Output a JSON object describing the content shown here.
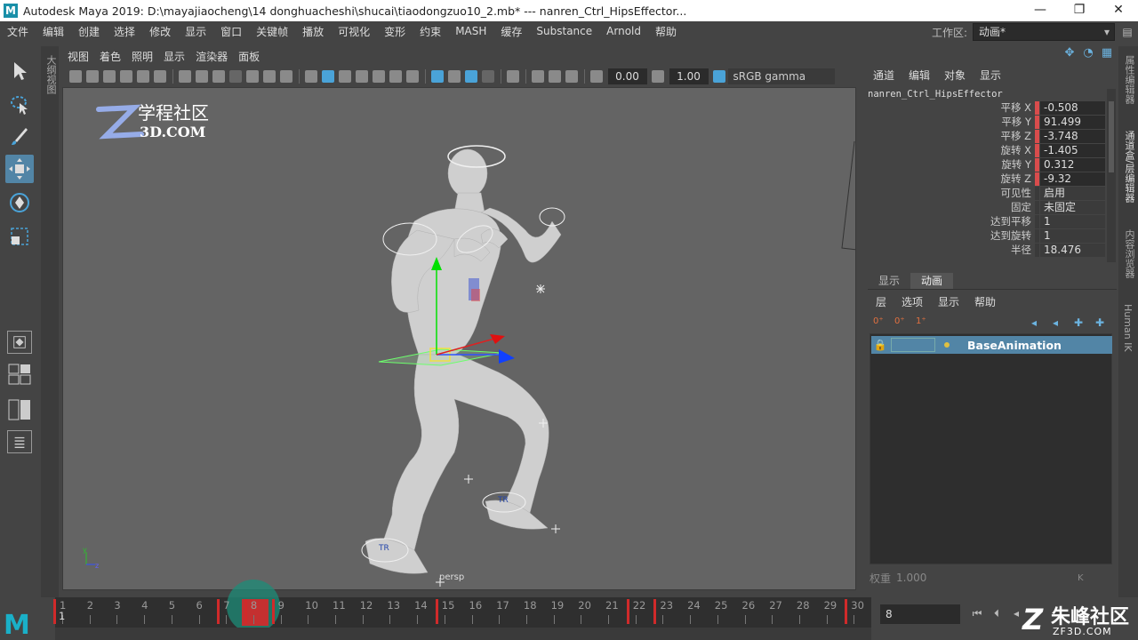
{
  "titlebar": {
    "title": "Autodesk Maya 2019: D:\\mayajiaocheng\\14 donghuacheshi\\shucai\\tiaodongzuo10_2.mb*   ---   nanren_Ctrl_HipsEffector...",
    "logo": "M",
    "buttons": [
      "—",
      "❐",
      "✕"
    ]
  },
  "menubar": {
    "items": [
      "文件",
      "编辑",
      "创建",
      "选择",
      "修改",
      "显示",
      "窗口",
      "关键帧",
      "播放",
      "可视化",
      "变形",
      "约束",
      "MASH",
      "缓存",
      "Substance",
      "Arnold",
      "帮助"
    ],
    "workspace_label": "工作区:",
    "workspace_value": "动画*"
  },
  "viewport": {
    "menus": [
      "视图",
      "着色",
      "照明",
      "显示",
      "渲染器",
      "面板"
    ],
    "near_value": "0.00",
    "far_value": "1.00",
    "color_space": "sRGB gamma",
    "camera": "persp",
    "outliner_tab": "大纲视图"
  },
  "watermark": {
    "cn": "学程社区",
    "en": "3D.COM"
  },
  "channel_box": {
    "menus": [
      "通道",
      "编辑",
      "对象",
      "显示"
    ],
    "node": "nanren_Ctrl_HipsEffector",
    "channels": [
      {
        "name": "平移 X",
        "value": "-0.508",
        "keyed": true
      },
      {
        "name": "平移 Y",
        "value": "91.499",
        "keyed": true
      },
      {
        "name": "平移 Z",
        "value": "-3.748",
        "keyed": true
      },
      {
        "name": "旋转 X",
        "value": "-1.405",
        "keyed": true
      },
      {
        "name": "旋转 Y",
        "value": "0.312",
        "keyed": true
      },
      {
        "name": "旋转 Z",
        "value": "-9.32",
        "keyed": true
      },
      {
        "name": "可见性",
        "value": "启用",
        "keyed": false
      },
      {
        "name": "固定",
        "value": "未固定",
        "keyed": false
      },
      {
        "name": "达到平移",
        "value": "1",
        "keyed": false
      },
      {
        "name": "达到旋转",
        "value": "1",
        "keyed": false
      },
      {
        "name": "半径",
        "value": "18.476",
        "keyed": false
      }
    ]
  },
  "layer_editor": {
    "tabs": [
      "显示",
      "动画"
    ],
    "menus": [
      "层",
      "选项",
      "显示",
      "帮助"
    ],
    "layer_name": "BaseAnimation",
    "weight_label": "权重",
    "weight_value": "1.000",
    "weight_key": "K"
  },
  "right_tabs": [
    "属性编辑器",
    "通道盒/层编辑器",
    "内容浏览器",
    "Human IK"
  ],
  "timeline": {
    "start": 1,
    "end": 30,
    "current_frame": "8",
    "key_frames": [
      1,
      7,
      8,
      9,
      15,
      22,
      23,
      30
    ]
  },
  "bottom_watermark": {
    "cn": "朱峰社区",
    "en": "ZF3D.COM"
  },
  "colors": {
    "accent_blue": "#5285a6",
    "key_red": "#d02a2a",
    "maya_teal": "#1ab0c8"
  }
}
